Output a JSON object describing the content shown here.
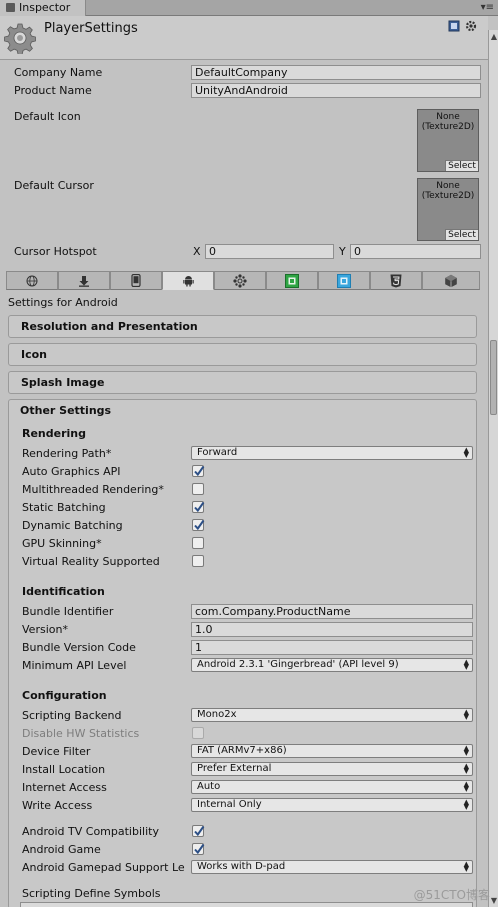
{
  "window": {
    "tab_title": "Inspector",
    "header_title": "PlayerSettings",
    "lock_symbol": "▫",
    "menu_symbol": "▾≡"
  },
  "fields": {
    "company_name": {
      "label": "Company Name",
      "value": "DefaultCompany"
    },
    "product_name": {
      "label": "Product Name",
      "value": "UnityAndAndroid"
    },
    "default_icon": {
      "label": "Default Icon",
      "texture_text": "None\n(Texture2D)",
      "select_label": "Select"
    },
    "default_cursor": {
      "label": "Default Cursor",
      "texture_text": "None\n(Texture2D)",
      "select_label": "Select"
    },
    "cursor_hotspot": {
      "label": "Cursor Hotspot",
      "x_label": "X",
      "x_value": "0",
      "y_label": "Y",
      "y_value": "0"
    }
  },
  "platform_tabs": [
    {
      "name": "globe-icon",
      "active": false
    },
    {
      "name": "download-icon",
      "active": false
    },
    {
      "name": "phone-icon",
      "active": false
    },
    {
      "name": "android-icon",
      "active": true
    },
    {
      "name": "blackberry-icon",
      "active": false
    },
    {
      "name": "xbox-icon",
      "active": false
    },
    {
      "name": "windows-store-icon",
      "active": false
    },
    {
      "name": "html5-icon",
      "active": false
    },
    {
      "name": "unity-cube-icon",
      "active": false
    }
  ],
  "settings_for": "Settings for Android",
  "sections": {
    "resolution": "Resolution and Presentation",
    "icon": "Icon",
    "splash": "Splash Image",
    "other": "Other Settings"
  },
  "rendering": {
    "title": "Rendering",
    "rendering_path": {
      "label": "Rendering Path*",
      "value": "Forward"
    },
    "auto_graphics_api": {
      "label": "Auto Graphics API",
      "checked": true
    },
    "multithreaded": {
      "label": "Multithreaded Rendering*",
      "checked": false
    },
    "static_batching": {
      "label": "Static Batching",
      "checked": true
    },
    "dynamic_batching": {
      "label": "Dynamic Batching",
      "checked": true
    },
    "gpu_skinning": {
      "label": "GPU Skinning*",
      "checked": false
    },
    "vr_supported": {
      "label": "Virtual Reality Supported",
      "checked": false
    }
  },
  "identification": {
    "title": "Identification",
    "bundle_identifier": {
      "label": "Bundle Identifier",
      "value": "com.Company.ProductName"
    },
    "version": {
      "label": "Version*",
      "value": "1.0"
    },
    "bundle_version_code": {
      "label": "Bundle Version Code",
      "value": "1"
    },
    "min_api_level": {
      "label": "Minimum API Level",
      "value": "Android 2.3.1 'Gingerbread' (API level 9)"
    }
  },
  "configuration": {
    "title": "Configuration",
    "scripting_backend": {
      "label": "Scripting Backend",
      "value": "Mono2x"
    },
    "disable_hw_stats": {
      "label": "Disable HW Statistics",
      "checked": false
    },
    "device_filter": {
      "label": "Device Filter",
      "value": "FAT (ARMv7+x86)"
    },
    "install_location": {
      "label": "Install Location",
      "value": "Prefer External"
    },
    "internet_access": {
      "label": "Internet Access",
      "value": "Auto"
    },
    "write_access": {
      "label": "Write Access",
      "value": "Internal Only"
    },
    "android_tv": {
      "label": "Android TV Compatibility",
      "checked": true
    },
    "android_game": {
      "label": "Android Game",
      "checked": true
    },
    "gamepad_support": {
      "label": "Android Gamepad Support Le",
      "value": "Works with D-pad"
    },
    "scripting_define_symbols": {
      "label": "Scripting Define Symbols"
    }
  },
  "watermark": "@51CTO博客",
  "colors": {
    "panel_bg": "#c2c2c2",
    "section_bg": "#c8c8c8",
    "field_bg": "#dadada",
    "check_blue": "#2c4f86"
  }
}
